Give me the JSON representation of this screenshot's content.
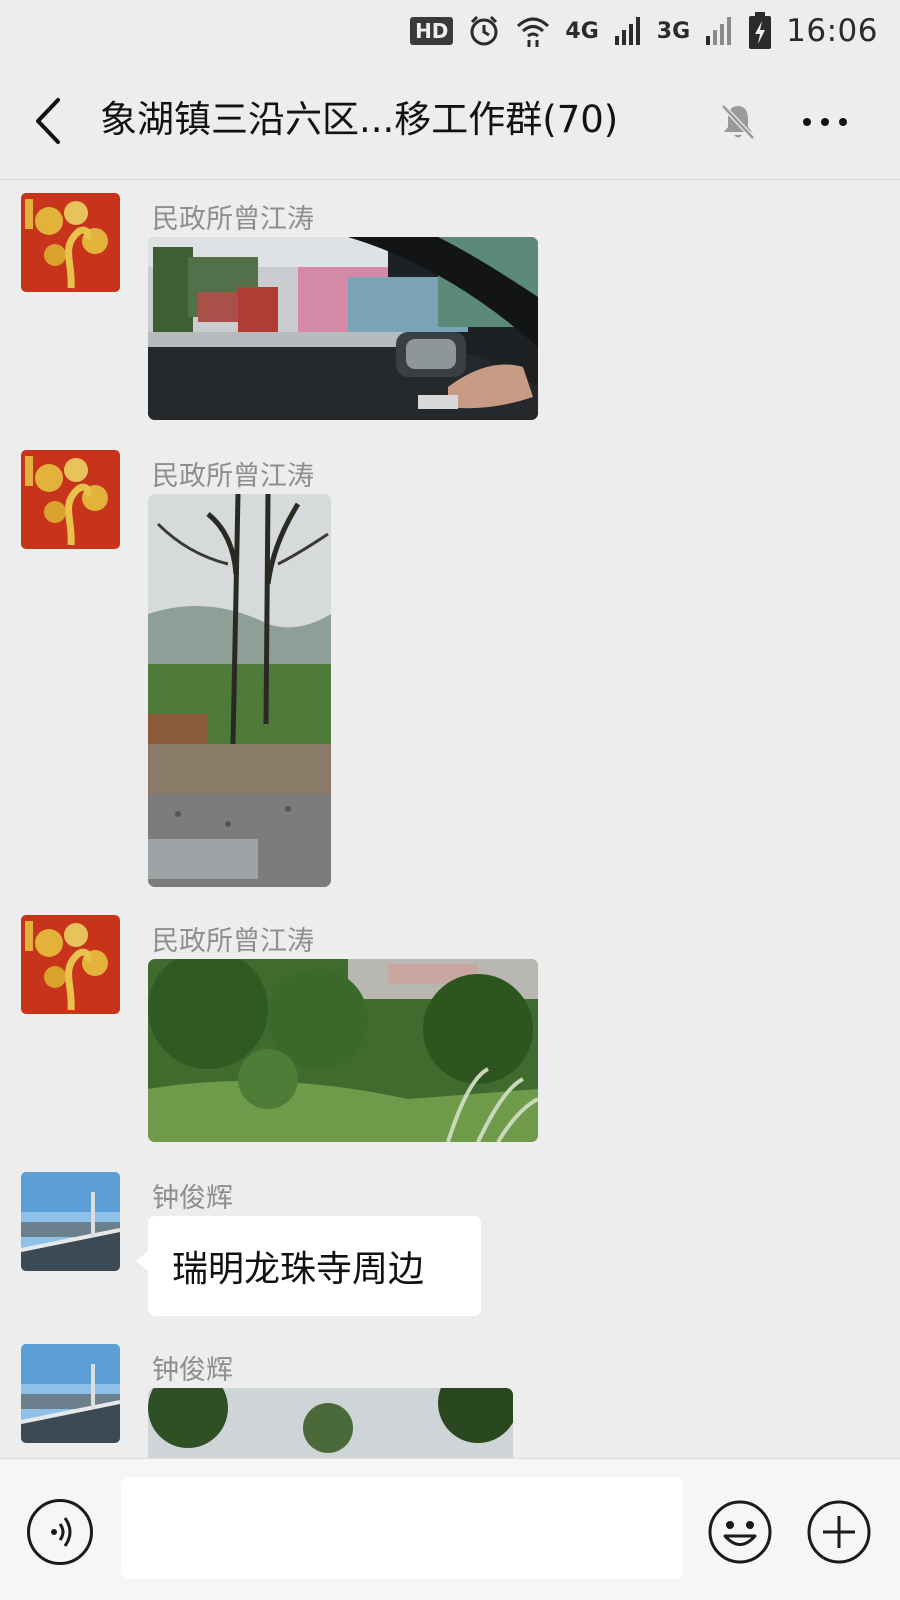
{
  "status_bar": {
    "hd": "HD",
    "net_4g": "4G",
    "net_3g": "3G",
    "time": "16:06",
    "icons": [
      "alarm-icon",
      "wifi-icon",
      "signal-icon",
      "battery-charging-icon"
    ]
  },
  "header": {
    "title": "象湖镇三沿六区...移工作群(70)",
    "icons": [
      "back-icon",
      "mute-bell-icon",
      "more-icon"
    ]
  },
  "messages": [
    {
      "sender": "民政所曾江涛",
      "type": "image",
      "content": "photo"
    },
    {
      "sender": "民政所曾江涛",
      "type": "image",
      "content": "photo"
    },
    {
      "sender": "民政所曾江涛",
      "type": "image",
      "content": "photo"
    },
    {
      "sender": "钟俊辉",
      "type": "text",
      "text": "瑞明龙珠寺周边"
    },
    {
      "sender": "钟俊辉",
      "type": "image",
      "content": "photo"
    }
  ],
  "input_bar": {
    "placeholder": "",
    "icons": [
      "voice-icon",
      "emoji-icon",
      "plus-icon"
    ]
  },
  "colors": {
    "background": "#ededed",
    "header_text": "#111111",
    "sender_text": "#8e8e8e",
    "bubble": "#ffffff",
    "avatar_red": "#c8331b",
    "avatar_gold": "#e2b23a"
  }
}
